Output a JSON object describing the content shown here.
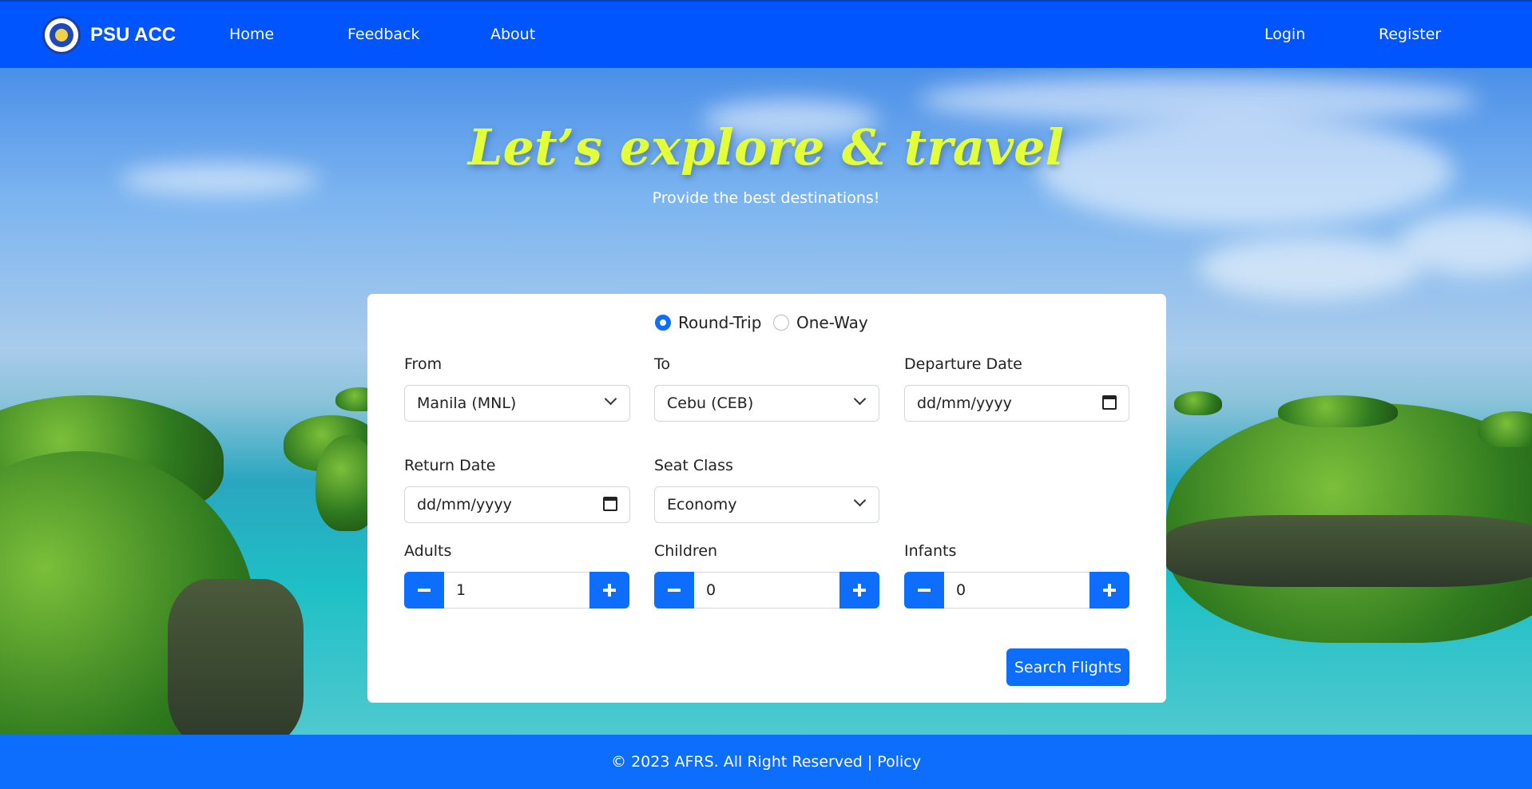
{
  "navbar": {
    "brand": "PSU ACC",
    "links": [
      "Home",
      "Feedback",
      "About"
    ],
    "login": "Login",
    "register": "Register"
  },
  "hero": {
    "title": "Let’s explore & travel",
    "subtitle": "Provide the best destinations!"
  },
  "form": {
    "trip_types": [
      "Round-Trip",
      "One-Way"
    ],
    "selected_trip": "Round-Trip",
    "from_label": "From",
    "from_value": "Manila (MNL)",
    "to_label": "To",
    "to_value": "Cebu (CEB)",
    "departure_label": "Departure Date",
    "departure_placeholder": "dd/mm/yyyy",
    "return_label": "Return Date",
    "return_placeholder": "dd/mm/yyyy",
    "seat_label": "Seat Class",
    "seat_value": "Economy",
    "adults_label": "Adults",
    "adults_value": "1",
    "children_label": "Children",
    "children_value": "0",
    "infants_label": "Infants",
    "infants_value": "0",
    "search_button": "Search Flights"
  },
  "footer": {
    "text": "© 2023 AFRS. All Right Reserved | Policy"
  },
  "colors": {
    "primary": "#0d6efd",
    "navbar": "#0055ff",
    "title": "#e3ff3a"
  }
}
